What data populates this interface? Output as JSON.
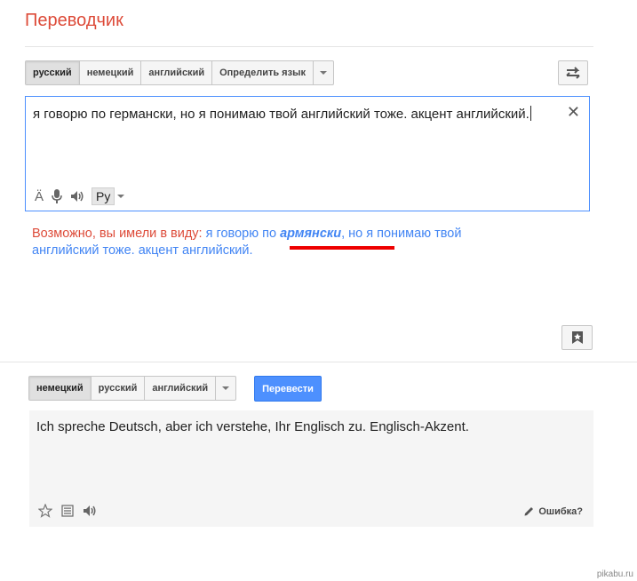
{
  "app": {
    "title": "Переводчик"
  },
  "source_langs": {
    "items": [
      {
        "label": "русский",
        "selected": true
      },
      {
        "label": "немецкий",
        "selected": false
      },
      {
        "label": "английский",
        "selected": false
      },
      {
        "label": "Определить язык",
        "selected": false
      }
    ]
  },
  "source": {
    "text": "я говорю по германски, но я понимаю твой английский тоже. акцент английский.",
    "ime_label": "Ру"
  },
  "suggestion": {
    "label": "Возможно, вы имели в виду:",
    "before": "я говорю по",
    "emph": "армянски",
    "after": ", но я понимаю твой английский тоже. акцент английский."
  },
  "target_langs": {
    "items": [
      {
        "label": "немецкий",
        "selected": true
      },
      {
        "label": "русский",
        "selected": false
      },
      {
        "label": "английский",
        "selected": false
      }
    ],
    "translate_label": "Перевести"
  },
  "target": {
    "text": "Ich spreche Deutsch, aber ich verstehe, Ihr Englisch zu. Englisch-Akzent.",
    "error_label": "Ошибка?"
  },
  "watermark": "pikabu.ru",
  "colors": {
    "brand_red": "#dd4b39",
    "suggest_blue": "#4285f4",
    "translate_blue": "#4d90fe",
    "underline_red": "#ee0000"
  },
  "icons": [
    "swap-icon",
    "clear-icon",
    "special-chars-icon",
    "microphone-icon",
    "speaker-icon",
    "bookmark-star-icon",
    "star-icon",
    "list-icon",
    "pencil-icon"
  ]
}
